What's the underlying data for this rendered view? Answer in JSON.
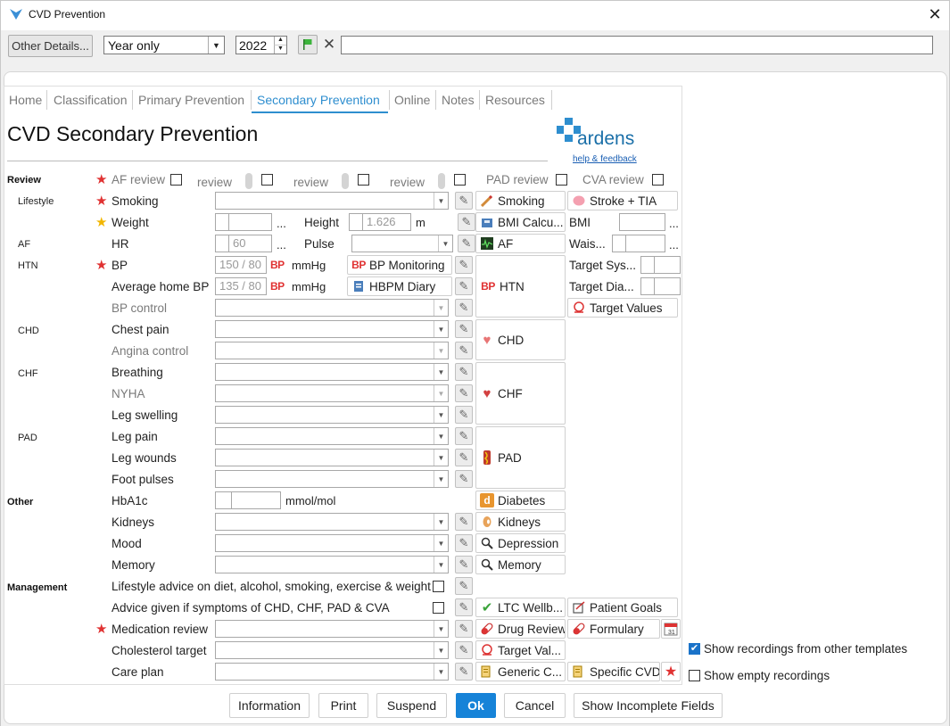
{
  "window": {
    "title": "CVD Prevention",
    "close_icon": "close-icon"
  },
  "toolbar": {
    "other_details_label": "Other Details...",
    "period_value": "Year only",
    "year_value": "2022",
    "search_value": ""
  },
  "tabs": [
    {
      "label": "Home",
      "active": false
    },
    {
      "label": "Classification",
      "active": false
    },
    {
      "label": "Primary Prevention",
      "active": false
    },
    {
      "label": "Secondary Prevention",
      "active": true
    },
    {
      "label": "Online",
      "active": false
    },
    {
      "label": "Notes",
      "active": false
    },
    {
      "label": "Resources",
      "active": false
    }
  ],
  "page": {
    "title": "CVD Secondary Prevention"
  },
  "logo": {
    "text": "ardens",
    "help_link": "help & feedback",
    "brand_color": "#1a6fa8",
    "accent_color": "#2e8ecf"
  },
  "sections": {
    "review": "Review",
    "lifestyle": "Lifestyle",
    "af": "AF",
    "htn": "HTN",
    "chd": "CHD",
    "chf": "CHF",
    "pad": "PAD",
    "other": "Other",
    "management": "Management"
  },
  "review_row": {
    "af_review": "AF review",
    "review1": "review",
    "review2": "review",
    "review3": "review",
    "pad_review": "PAD review",
    "cva_review": "CVA review"
  },
  "fields": {
    "smoking": "Smoking",
    "weight": "Weight",
    "height": "Height",
    "height_value": "1.626",
    "height_unit": "m",
    "hr": "HR",
    "hr_value": "60",
    "pulse": "Pulse",
    "bp": "BP",
    "bp_value": "150 / 80",
    "bp_badge": "BP",
    "bp_unit": "mmHg",
    "avg_home_bp": "Average home BP",
    "avg_home_bp_value": "135 / 80",
    "avg_home_bp_badge": "BP",
    "avg_home_bp_unit": "mmHg",
    "bp_control": "BP control",
    "chest_pain": "Chest pain",
    "angina_control": "Angina control",
    "breathing": "Breathing",
    "nyha": "NYHA",
    "leg_swelling": "Leg swelling",
    "leg_pain": "Leg pain",
    "leg_wounds": "Leg wounds",
    "foot_pulses": "Foot pulses",
    "hba1c": "HbA1c",
    "hba1c_unit": "mmol/mol",
    "kidneys": "Kidneys",
    "mood": "Mood",
    "memory": "Memory",
    "lifestyle_advice": "Lifestyle advice on diet, alcohol, smoking, exercise & weight",
    "advice_given": "Advice given if symptoms of CHD, CHF, PAD & CVA",
    "medication_review": "Medication review",
    "cholesterol_target": "Cholesterol target",
    "care_plan": "Care plan",
    "ellipsis": "..."
  },
  "link_buttons": {
    "smoking": "Smoking",
    "stroke_tia": "Stroke + TIA",
    "bmi_calc": "BMI Calcu...",
    "af": "AF",
    "bp_monitoring": "BP Monitoring",
    "hbpm_diary": "HBPM Diary",
    "htn": "HTN",
    "htn_badge": "BP",
    "target_values": "Target Values",
    "chd": "CHD",
    "chf": "CHF",
    "pad": "PAD",
    "diabetes": "Diabetes",
    "kidneys": "Kidneys",
    "depression": "Depression",
    "memory": "Memory",
    "ltc_wellbeing": "LTC Wellb...",
    "patient_goals": "Patient Goals",
    "drug_review": "Drug Review",
    "formulary": "Formulary",
    "target_val": "Target Val...",
    "generic_c": "Generic C...",
    "specific_cvd": "Specific CVD"
  },
  "side_fields": {
    "bmi": "BMI",
    "waist": "Wais...",
    "target_sys": "Target Sys...",
    "target_dia": "Target Dia..."
  },
  "options": {
    "show_other_templates": {
      "label": "Show recordings from other templates",
      "checked": true
    },
    "show_empty": {
      "label": "Show empty recordings",
      "checked": false
    }
  },
  "bottom_buttons": {
    "information": "Information",
    "print": "Print",
    "suspend": "Suspend",
    "ok": "Ok",
    "cancel": "Cancel",
    "show_incomplete": "Show Incomplete Fields"
  },
  "colors": {
    "required_star": "#e03232",
    "optional_star": "#f2b600",
    "ok_button": "#1683d8"
  }
}
